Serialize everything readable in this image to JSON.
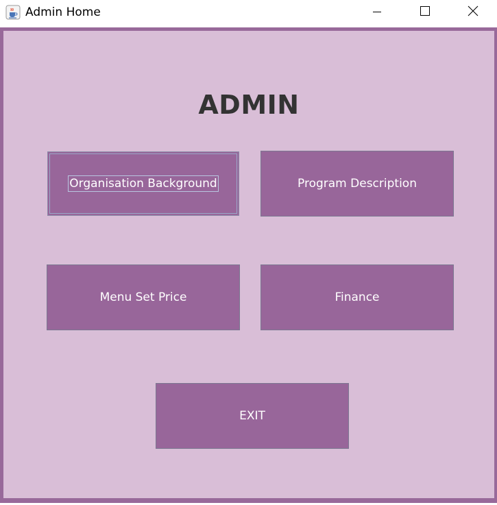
{
  "window": {
    "title": "Admin Home",
    "app_icon": "java-coffee-icon",
    "controls": {
      "minimize_icon": "minimize-icon",
      "maximize_icon": "maximize-icon",
      "close_icon": "close-icon"
    }
  },
  "main": {
    "heading": "ADMIN",
    "buttons": {
      "organisation_background": "Organisation Background",
      "program_description": "Program Description",
      "menu_set_price": "Menu Set Price",
      "finance": "Finance",
      "exit": "EXIT"
    },
    "focused_button": "organisation_background"
  },
  "colors": {
    "frame": "#98699a",
    "background": "#d9bed7",
    "button": "#98669a",
    "button_text": "#ffffff",
    "heading": "#333333"
  }
}
